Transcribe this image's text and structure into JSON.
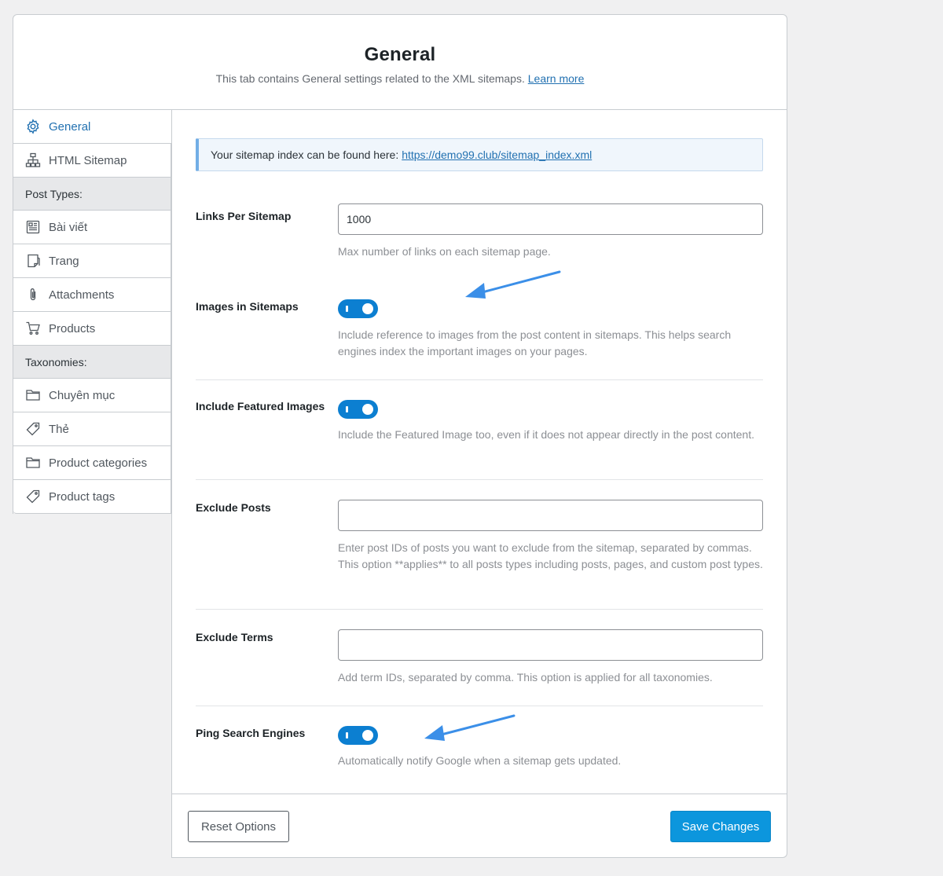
{
  "header": {
    "title": "General",
    "subtitle": "This tab contains General settings related to the XML sitemaps.",
    "learn_more": "Learn more"
  },
  "sidebar": {
    "items": [
      {
        "label": "General",
        "icon": "gear-icon",
        "active": true
      },
      {
        "label": "HTML Sitemap",
        "icon": "sitemap-icon"
      },
      {
        "section": "Post Types:"
      },
      {
        "label": "Bài viết",
        "icon": "post-icon"
      },
      {
        "label": "Trang",
        "icon": "page-icon"
      },
      {
        "label": "Attachments",
        "icon": "paperclip-icon"
      },
      {
        "label": "Products",
        "icon": "cart-icon"
      },
      {
        "section": "Taxonomies:"
      },
      {
        "label": "Chuyên mục",
        "icon": "folder-icon"
      },
      {
        "label": "Thẻ",
        "icon": "tag-icon"
      },
      {
        "label": "Product categories",
        "icon": "folder-icon"
      },
      {
        "label": "Product tags",
        "icon": "tag-icon"
      }
    ]
  },
  "notice": {
    "text": "Your sitemap index can be found here:",
    "link": "https://demo99.club/sitemap_index.xml"
  },
  "settings": {
    "links_per_sitemap": {
      "label": "Links Per Sitemap",
      "value": "1000",
      "desc": "Max number of links on each sitemap page."
    },
    "images_in_sitemaps": {
      "label": "Images in Sitemaps",
      "enabled": true,
      "desc": "Include reference to images from the post content in sitemaps. This helps search engines index the important images on your pages."
    },
    "include_featured_images": {
      "label": "Include Featured Images",
      "enabled": true,
      "desc": "Include the Featured Image too, even if it does not appear directly in the post content."
    },
    "exclude_posts": {
      "label": "Exclude Posts",
      "value": "",
      "desc": "Enter post IDs of posts you want to exclude from the sitemap, separated by commas. This option **applies** to all posts types including posts, pages, and custom post types."
    },
    "exclude_terms": {
      "label": "Exclude Terms",
      "value": "",
      "desc": "Add term IDs, separated by comma. This option is applied for all taxonomies."
    },
    "ping_search_engines": {
      "label": "Ping Search Engines",
      "enabled": true,
      "desc": "Automatically notify Google when a sitemap gets updated."
    }
  },
  "footer": {
    "reset_label": "Reset Options",
    "save_label": "Save Changes"
  },
  "colors": {
    "accent": "#0c96dd",
    "toggle_on": "#0c7fd1",
    "annotation_arrow": "#3b8fe8"
  }
}
